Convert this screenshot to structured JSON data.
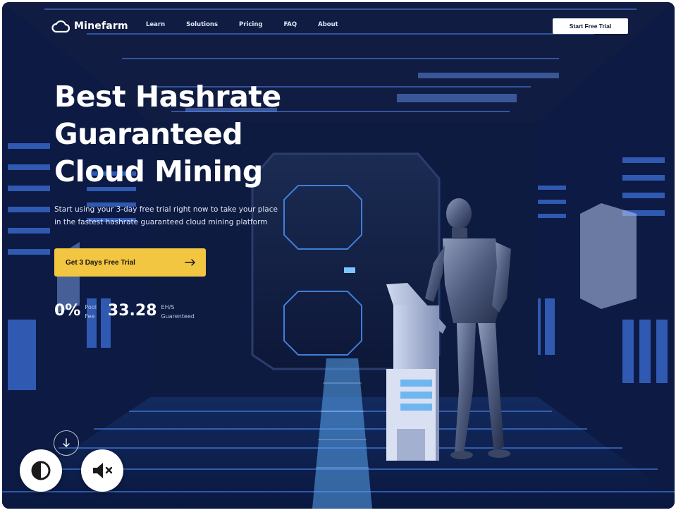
{
  "nav": {
    "brand": "Minefarm",
    "links": [
      "Learn",
      "Solutions",
      "Pricing",
      "FAQ",
      "About"
    ],
    "cta": "Start Free Trial"
  },
  "hero": {
    "title_lines": [
      "Best Hashrate",
      "Guaranteed",
      "Cloud Mining"
    ],
    "subtitle_lines": [
      "Start using your 3-day free trial right now to take your place",
      "in the fastest hashrate guaranteed cloud mining platform"
    ],
    "cta": "Get 3 Days Free Trial",
    "stats": [
      {
        "value": "0%",
        "label_lines": [
          "Pool",
          "Fee"
        ]
      },
      {
        "value": "33.28",
        "label_lines": [
          "EH/S",
          "Guarenteed"
        ]
      }
    ]
  },
  "icons": {
    "logo": "cloud-icon",
    "cta_arrow": "arrow-right-icon",
    "scroll": "arrow-down-icon",
    "contrast": "contrast-icon",
    "mute": "volume-muted-icon"
  },
  "colors": {
    "accent": "#f2c641",
    "background": "#0a1430",
    "text": "#ffffff"
  }
}
